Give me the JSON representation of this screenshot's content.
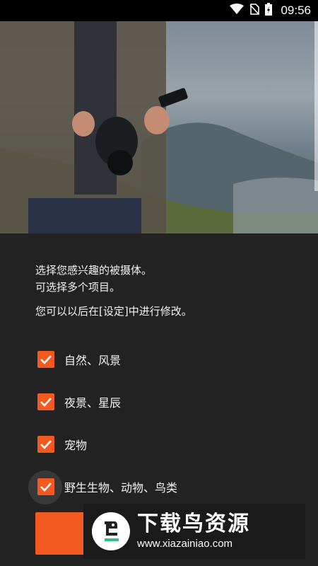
{
  "status_bar": {
    "time": "09:56",
    "icons": [
      "wifi-icon",
      "no-sim-icon",
      "battery-charging-icon"
    ]
  },
  "hero": {
    "image": "photographer-with-camera-and-phone-on-mountain"
  },
  "intro": {
    "line1": "选择您感兴趣的被摄体。",
    "line2": "可选择多个项目。",
    "note": "您可以以后在[设定]中进行修改。"
  },
  "options": [
    {
      "label": "自然、风景",
      "checked": true
    },
    {
      "label": "夜景、星辰",
      "checked": true
    },
    {
      "label": "宠物",
      "checked": true
    },
    {
      "label": "野生生物、动物、鸟类",
      "checked": true
    }
  ],
  "watermark": {
    "title": "下载鸟资源",
    "url": "www.xiazainiao.com"
  },
  "colors": {
    "accent": "#f25a22",
    "background": "#222222"
  }
}
